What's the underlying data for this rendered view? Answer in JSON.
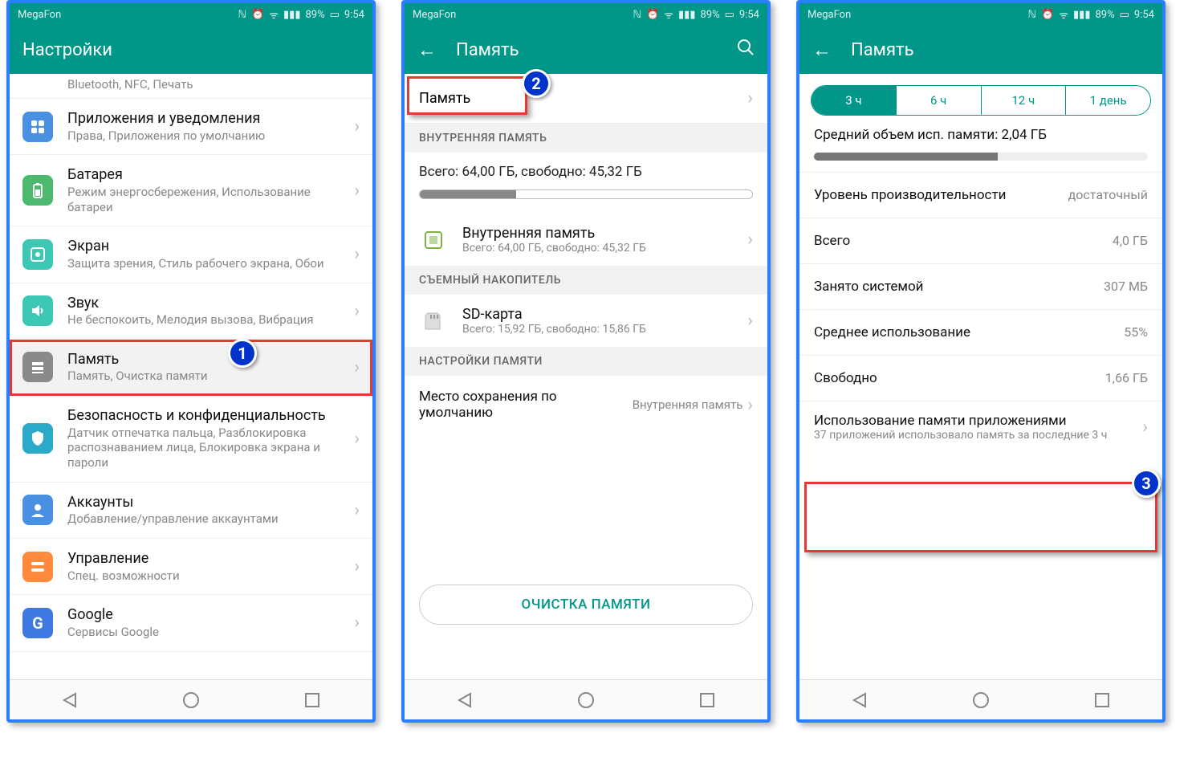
{
  "statusbar": {
    "carrier": "MegaFon",
    "battery": "89%",
    "time": "9:54"
  },
  "badges": {
    "b1": "1",
    "b2": "2",
    "b3": "3"
  },
  "screen1": {
    "title": "Настройки",
    "partial": "Bluetooth, NFC, Печать",
    "items": [
      {
        "icon": "apps",
        "iconcls": "ic-blue",
        "title": "Приложения и уведомления",
        "sub": "Права, Приложения по умолчанию"
      },
      {
        "icon": "battery",
        "iconcls": "ic-green",
        "title": "Батарея",
        "sub": "Режим энергосбережения, Использование батареи"
      },
      {
        "icon": "display",
        "iconcls": "ic-teal",
        "title": "Экран",
        "sub": "Защита зрения, Стиль рабочего экрана, Обои"
      },
      {
        "icon": "sound",
        "iconcls": "ic-teal",
        "title": "Звук",
        "sub": "Не беспокоить, Мелодия вызова, Вибрация"
      },
      {
        "icon": "memory",
        "iconcls": "ic-gray",
        "title": "Память",
        "sub": "Память, Очистка памяти",
        "hl": true
      },
      {
        "icon": "shield",
        "iconcls": "ic-cyan",
        "title": "Безопасность и конфиденциальность",
        "sub": "Датчик отпечатка пальца, Разблокировка распознаванием лица, Блокировка экрана и пароли"
      },
      {
        "icon": "account",
        "iconcls": "ic-blue",
        "title": "Аккаунты",
        "sub": "Добавление/управление аккаунтами"
      },
      {
        "icon": "manage",
        "iconcls": "ic-orange",
        "title": "Управление",
        "sub": "Спец. возможности"
      },
      {
        "icon": "G",
        "iconcls": "ic-g2",
        "title": "Google",
        "sub": "Сервисы Google"
      }
    ]
  },
  "screen2": {
    "title": "Память",
    "ram_label": "Память",
    "sec_internal": "ВНУТРЕННЯЯ ПАМЯТЬ",
    "total_line": "Всего: 64,00 ГБ, свободно: 45,32 ГБ",
    "progress_pct": 29,
    "internal": {
      "title": "Внутренняя память",
      "sub": "Всего: 64,00 ГБ, свободно: 45,32 ГБ"
    },
    "sec_removable": "СЪЕМНЫЙ НАКОПИТЕЛЬ",
    "sd": {
      "title": "SD-карта",
      "sub": "Всего: 15,92 ГБ, свободно: 15,86 ГБ"
    },
    "sec_settings": "НАСТРОЙКИ ПАМЯТИ",
    "default_loc": {
      "title": "Место сохранения по умолчанию",
      "value": "Внутренняя память"
    },
    "clean_btn": "ОЧИСТКА ПАМЯТИ"
  },
  "screen3": {
    "title": "Память",
    "seg": [
      "3 ч",
      "6 ч",
      "12 ч",
      "1 день"
    ],
    "avg": "Средний объем исп. памяти: 2,04 ГБ",
    "ram_pct": 55,
    "rows": [
      {
        "k": "Уровень производительности",
        "v": "достаточный"
      },
      {
        "k": "Всего",
        "v": "4,0 ГБ"
      },
      {
        "k": "Занято системой",
        "v": "307 МБ"
      },
      {
        "k": "Среднее использование",
        "v": "55%"
      },
      {
        "k": "Свободно",
        "v": "1,66 ГБ"
      }
    ],
    "app_use": {
      "title": "Использование памяти приложениями",
      "sub": "37 приложений использовало память за последние 3 ч"
    }
  }
}
